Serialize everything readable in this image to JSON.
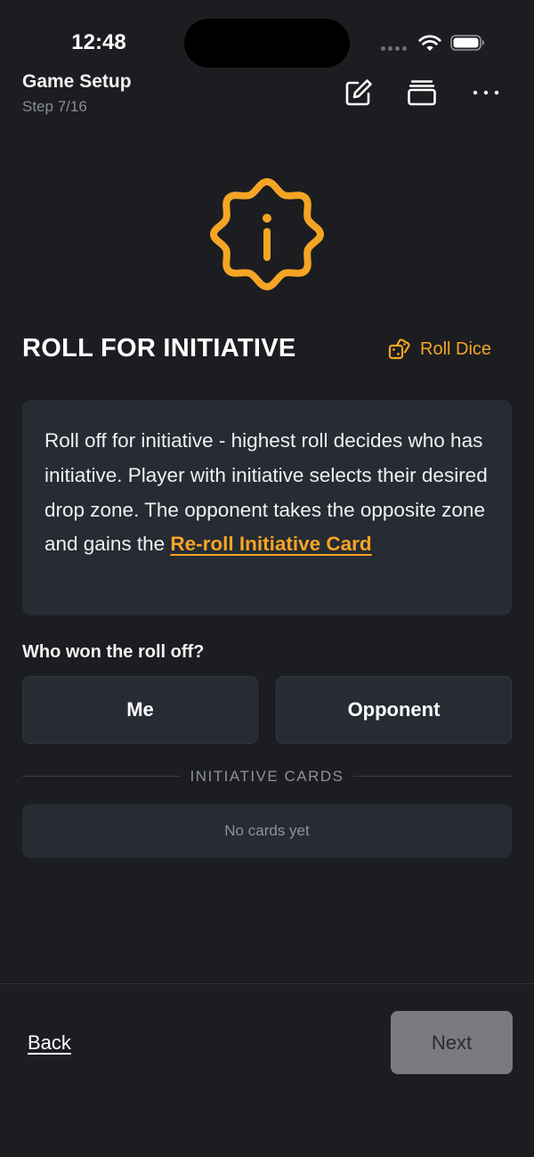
{
  "status_bar": {
    "time": "12:48",
    "icons": [
      "signal-dots-icon",
      "wifi-icon",
      "battery-icon"
    ]
  },
  "header": {
    "title": "Game Setup",
    "subtitle": "Step 7/16",
    "actions": [
      "edit-icon",
      "cards-stack-icon",
      "more-icon"
    ]
  },
  "hero": {
    "icon": "info-badge-icon"
  },
  "section": {
    "title": "ROLL FOR INITIATIVE",
    "roll_dice_label": "Roll Dice",
    "roll_dice_icon": "dice-icon"
  },
  "info": {
    "text": "Roll off for initiative - highest roll decides who has initiative. Player with initiative selects their desired drop zone. The opponent takes the opposite zone and gains the ",
    "link_text": "Re-roll Initiative Card"
  },
  "question": {
    "label": "Who won the roll off?",
    "options": [
      "Me",
      "Opponent"
    ]
  },
  "initiative_cards": {
    "heading": "INITIATIVE CARDS",
    "empty_text": "No cards yet"
  },
  "footer": {
    "back_label": "Back",
    "next_label": "Next"
  },
  "colors": {
    "background": "#1b1d21",
    "card": "#272b33",
    "accent": "#f5a524",
    "muted_text": "#8f9298",
    "disabled_button": "#7a7b7f"
  }
}
